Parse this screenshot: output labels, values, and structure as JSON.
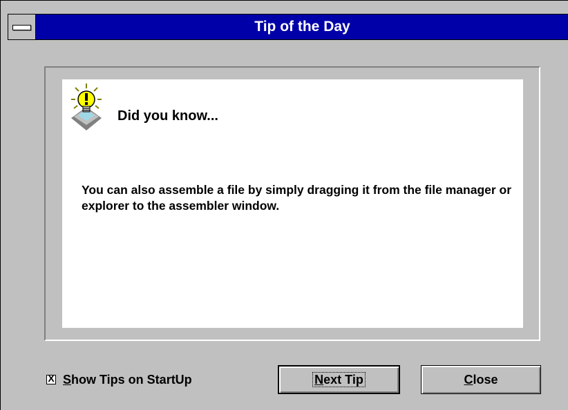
{
  "window": {
    "title": "Tip of the Day",
    "colors": {
      "titlebar": "#0000a8",
      "face": "#c0c0c0",
      "panel": "#ffffff"
    }
  },
  "tip": {
    "icon": "lightbulb-icon",
    "heading": "Did you know...",
    "text": "You can also assemble a file by simply dragging it from the file manager or explorer to the assembler window."
  },
  "show_tips": {
    "checked": true,
    "mark": "X",
    "label_first": "S",
    "label_rest": "how Tips on StartUp"
  },
  "buttons": {
    "next_first": "N",
    "next_rest": "ext Tip",
    "close_first": "C",
    "close_rest": "lose"
  }
}
